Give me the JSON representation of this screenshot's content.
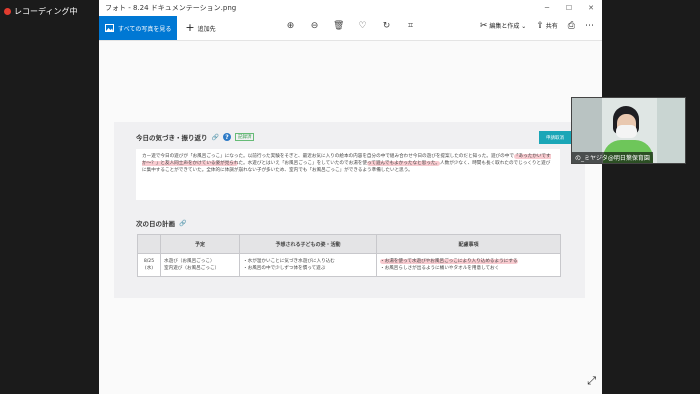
{
  "recording": {
    "label": "レコーディング中"
  },
  "window": {
    "title": "フォト - 8.24 ドキュメンテーション.png",
    "controls": {
      "minimize": "─",
      "maximize": "☐",
      "close": "✕"
    }
  },
  "toolbar": {
    "all_photos": "すべての写真を見る",
    "add_to": "追加先",
    "edit_create": "編集と作成",
    "share": "共有"
  },
  "document": {
    "section1_title": "今日の気づき・振り返り",
    "badge": "記録済",
    "apply_button": "申請取消",
    "reflection_before": "カー遊で今日の遊びが「お風呂ごっこ」になった。以前行った実験をそぎと、最近お気に入りの絵本の内容を自分の中で組み合わせ今日の遊びを提案したのだと知った。遊びの中で",
    "reflection_hl1": "「あったかいですか〜？」と友人同士声をかけている姿が見られ",
    "reflection_mid": "た。水遊びとはいえ「お風呂ごっこ」をしていたのでお湯を使",
    "reflection_hl2": "って遊んでもよかったなと思った。",
    "reflection_after": "人数が少なく、時間も長く取れたのでじっくりと遊びに集中することができていた。全体的に体調が崩れない子が多いため、室内でも「お風呂ごっこ」ができるよう準備したいと思う。",
    "section2_title": "次の日の計画",
    "table": {
      "headers": [
        "",
        "予定",
        "予想される子どもの姿・活動",
        "配慮事項"
      ],
      "date": "8/25\n(水)",
      "plan": "水遊び（お風呂ごっこ）\n室内遊び（お風呂ごっこ）",
      "expected": "・水が温かいことに気づき水遊びに入り込む\n・お風呂の中で少しずつ体を慣って遊ぶ",
      "care_hl": "・お湯を使って水遊びやお風呂ごっこにより入り込めるようにする",
      "care_rest": "・お風呂らしさが出るように桶いやタオルを用意しておく"
    }
  },
  "video": {
    "name": "の_ミヤジタ@明日葉保育園"
  }
}
